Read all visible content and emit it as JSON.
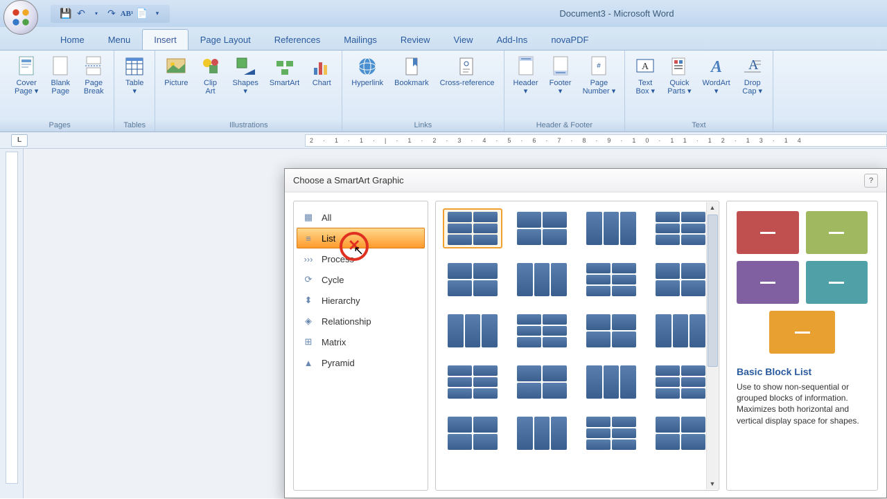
{
  "window": {
    "title": "Document3 - Microsoft Word"
  },
  "tabs": [
    "Home",
    "Menu",
    "Insert",
    "Page Layout",
    "References",
    "Mailings",
    "Review",
    "View",
    "Add-Ins",
    "novaPDF"
  ],
  "active_tab": 2,
  "ribbon_groups": [
    {
      "label": "Pages",
      "items": [
        {
          "name": "cover-page",
          "label": "Cover\nPage ▾"
        },
        {
          "name": "blank-page",
          "label": "Blank\nPage"
        },
        {
          "name": "page-break",
          "label": "Page\nBreak"
        }
      ]
    },
    {
      "label": "Tables",
      "items": [
        {
          "name": "table",
          "label": "Table\n▾"
        }
      ]
    },
    {
      "label": "Illustrations",
      "items": [
        {
          "name": "picture",
          "label": "Picture"
        },
        {
          "name": "clip-art",
          "label": "Clip\nArt"
        },
        {
          "name": "shapes",
          "label": "Shapes\n▾"
        },
        {
          "name": "smartart",
          "label": "SmartArt"
        },
        {
          "name": "chart",
          "label": "Chart"
        }
      ]
    },
    {
      "label": "Links",
      "items": [
        {
          "name": "hyperlink",
          "label": "Hyperlink"
        },
        {
          "name": "bookmark",
          "label": "Bookmark"
        },
        {
          "name": "cross-reference",
          "label": "Cross-reference"
        }
      ]
    },
    {
      "label": "Header & Footer",
      "items": [
        {
          "name": "header",
          "label": "Header\n▾"
        },
        {
          "name": "footer",
          "label": "Footer\n▾"
        },
        {
          "name": "page-number",
          "label": "Page\nNumber ▾"
        }
      ]
    },
    {
      "label": "Text",
      "items": [
        {
          "name": "text-box",
          "label": "Text\nBox ▾"
        },
        {
          "name": "quick-parts",
          "label": "Quick\nParts ▾"
        },
        {
          "name": "wordart",
          "label": "WordArt\n▾"
        },
        {
          "name": "drop-cap",
          "label": "Drop\nCap ▾"
        }
      ]
    }
  ],
  "dialog": {
    "title": "Choose a SmartArt Graphic",
    "categories": [
      "All",
      "List",
      "Process",
      "Cycle",
      "Hierarchy",
      "Relationship",
      "Matrix",
      "Pyramid"
    ],
    "selected_category": 1,
    "preview": {
      "title": "Basic Block List",
      "desc": "Use to show non-sequential or grouped blocks of information. Maximizes both horizontal and vertical display space for shapes."
    }
  }
}
